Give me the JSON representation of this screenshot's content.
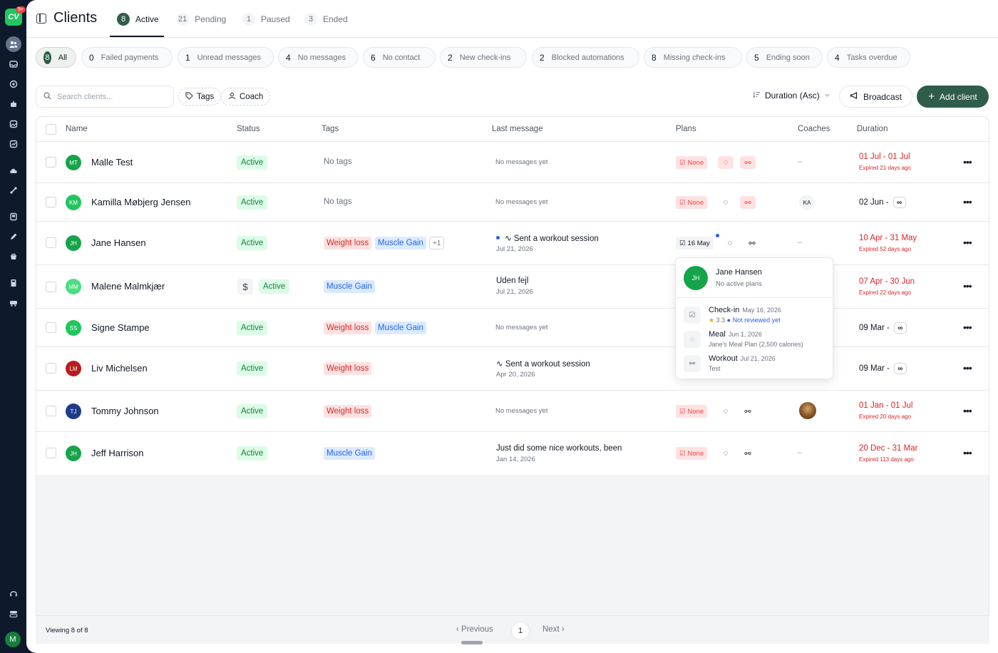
{
  "sidebar": {
    "logo_text": "CV",
    "logo_badge": "9+",
    "avatar_initial": "M",
    "icons": [
      "clients-icon",
      "inbox-icon",
      "target-icon",
      "bot-icon",
      "gallery-icon",
      "analytics-icon",
      "cloud-icon",
      "link-icon",
      "book-icon",
      "pen-icon",
      "cup-icon",
      "calculator-icon",
      "train-icon",
      "headset-icon",
      "toggle-icon"
    ]
  },
  "header": {
    "title": "Clients",
    "tabs": [
      {
        "count": "8",
        "label": "Active"
      },
      {
        "count": "21",
        "label": "Pending"
      },
      {
        "count": "1",
        "label": "Paused"
      },
      {
        "count": "3",
        "label": "Ended"
      }
    ]
  },
  "filters": [
    {
      "count": "8",
      "label": "All"
    },
    {
      "count": "0",
      "label": "Failed payments"
    },
    {
      "count": "1",
      "label": "Unread messages"
    },
    {
      "count": "4",
      "label": "No messages"
    },
    {
      "count": "6",
      "label": "No contact"
    },
    {
      "count": "2",
      "label": "New check-ins"
    },
    {
      "count": "2",
      "label": "Blocked automations"
    },
    {
      "count": "8",
      "label": "Missing check-ins"
    },
    {
      "count": "5",
      "label": "Ending soon"
    },
    {
      "count": "4",
      "label": "Tasks overdue"
    }
  ],
  "toolbar": {
    "search_placeholder": "Search clients...",
    "tags_label": "Tags",
    "coach_label": "Coach",
    "sort_label": "Duration (Asc)",
    "broadcast_label": "Broadcast",
    "add_client_label": "Add client"
  },
  "table": {
    "columns": [
      "Name",
      "Status",
      "Tags",
      "Last message",
      "Plans",
      "Coaches",
      "Duration"
    ],
    "rows": [
      {
        "initials": "MT",
        "name": "Malle Test",
        "status": "Active",
        "tags_text": "No tags",
        "msg_none": "No messages yet",
        "plan_none": "None",
        "coach_dash": "–",
        "dur_main": "01 Jul - 01 Jul",
        "dur_sub": "Expired 21 days ago"
      },
      {
        "initials": "KM",
        "name": "Kamilla Møbjerg Jensen",
        "status": "Active",
        "tags_text": "No tags",
        "msg_none": "No messages yet",
        "plan_none": "None",
        "coach_initials": "KA",
        "dur_main": "02 Jun -"
      },
      {
        "initials": "JH",
        "name": "Jane Hansen",
        "status": "Active",
        "tags": [
          "Weight loss",
          "Muscle Gain",
          "+1"
        ],
        "msg_title": "Sent a workout session",
        "msg_date": "Jul 21, 2026",
        "plan_date": "16 May",
        "coach_dash": "–",
        "dur_main": "10 Apr - 31 May",
        "dur_sub": "Expired 52 days ago"
      },
      {
        "initials": "MM",
        "name": "Malene Malmkjær",
        "status": "Active",
        "dollar": "$",
        "tags": [
          "Muscle Gain"
        ],
        "msg_title": "Uden fejl",
        "msg_date": "Jul 21, 2026",
        "dur_main": "07 Apr - 30 Jun",
        "dur_sub": "Expired 22 days ago"
      },
      {
        "initials": "SS",
        "name": "Signe Stampe",
        "status": "Active",
        "tags": [
          "Weight loss",
          "Muscle Gain"
        ],
        "msg_none": "No messages yet",
        "dur_main": "09 Mar -"
      },
      {
        "initials": "LM",
        "name": "Liv Michelsen",
        "status": "Active",
        "tags": [
          "Weight loss"
        ],
        "msg_title": "Sent a workout session",
        "msg_date": "Apr 20, 2026",
        "dur_main": "09 Mar -"
      },
      {
        "initials": "TJ",
        "name": "Tommy Johnson",
        "status": "Active",
        "tags": [
          "Weight loss"
        ],
        "msg_none": "No messages yet",
        "plan_none": "None",
        "dur_main": "01 Jan - 01 Jul",
        "dur_sub": "Expired 20 days ago"
      },
      {
        "initials": "JH",
        "name": "Jeff Harrison",
        "status": "Active",
        "tags": [
          "Muscle Gain"
        ],
        "msg_title": "Just did some nice workouts, been",
        "msg_date": "Jan 14, 2026",
        "plan_none": "None",
        "coach_dash": "–",
        "dur_main": "20 Dec - 31 Mar",
        "dur_sub": "Expired 113 days ago"
      }
    ]
  },
  "popover": {
    "initials": "JH",
    "name": "Jane Hansen",
    "subtitle": "No active plans",
    "checkin_title": "Check-in",
    "checkin_date": "May 16, 2026",
    "checkin_rating": "3.3",
    "checkin_status": "Not reviewed yet",
    "meal_title": "Meal",
    "meal_date": "Jun 1, 2026",
    "meal_detail": "Jane's Meal Plan (2,500 calories)",
    "workout_title": "Workout",
    "workout_date": "Jul 21, 2026",
    "workout_detail": "Test"
  },
  "footer": {
    "viewing": "Viewing 8 of 8",
    "previous": "Previous",
    "page": "1",
    "next": "Next"
  },
  "colors": {
    "accent": "#2f5d4a",
    "active_green": "#15803d",
    "expired_red": "#dc2626",
    "tag_blue": "#2563eb"
  }
}
